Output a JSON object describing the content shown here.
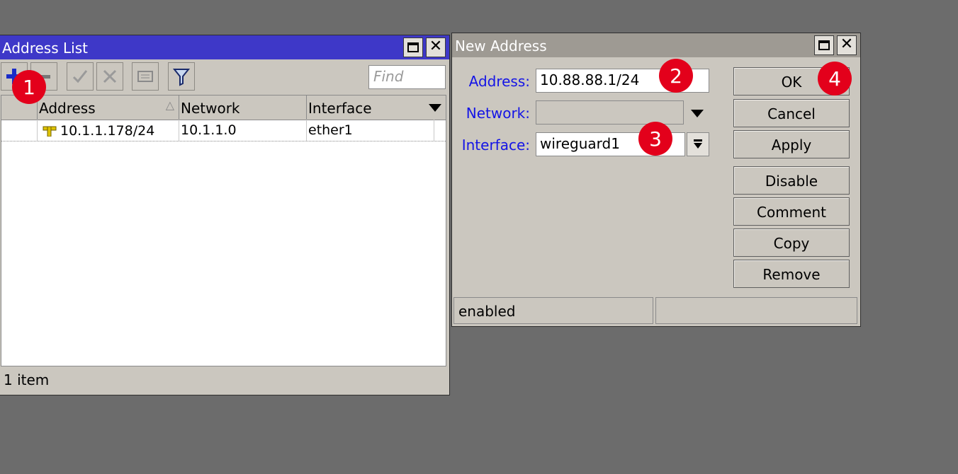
{
  "address_list": {
    "title": "Address List",
    "toolbar": {
      "add": "add-icon",
      "remove": "remove-icon",
      "enable": "check-icon",
      "disable": "x-icon",
      "comment": "comment-icon",
      "filter": "filter-icon"
    },
    "find_placeholder": "Find",
    "columns": [
      "Address",
      "Network",
      "Interface"
    ],
    "rows": [
      {
        "address": "10.1.1.178/24",
        "network": "10.1.1.0",
        "interface": "ether1"
      }
    ],
    "status": "1 item"
  },
  "new_address": {
    "title": "New Address",
    "fields": {
      "address_label": "Address:",
      "address_value": "10.88.88.1/24",
      "network_label": "Network:",
      "network_value": "",
      "interface_label": "Interface:",
      "interface_value": "wireguard1"
    },
    "buttons": [
      "OK",
      "Cancel",
      "Apply",
      "Disable",
      "Comment",
      "Copy",
      "Remove"
    ],
    "status": "enabled",
    "status2": ""
  },
  "badges": [
    "1",
    "2",
    "3",
    "4"
  ],
  "colors": {
    "badge": "#e3001b",
    "title_active": "#3e38c8",
    "title_inactive": "#9e9a93",
    "label": "#1414e6"
  }
}
